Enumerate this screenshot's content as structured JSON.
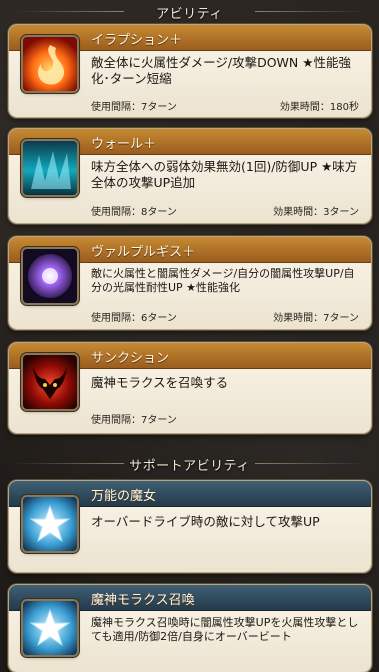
{
  "sections": {
    "abilities": "アビリティ",
    "support": "サポートアビリティ"
  },
  "abilities": [
    {
      "name": "イラプション＋",
      "desc": "敵全体に火属性ダメージ/攻撃DOWN ★性能強化･ターン短縮",
      "cooldown": "使用間隔：7ターン",
      "duration": "効果時間：180秒",
      "icon": "flame-icon",
      "color": "#d23a15"
    },
    {
      "name": "ウォール＋",
      "desc": "味方全体への弱体効果無効(1回)/防御UP ★味方全体の攻撃UP追加",
      "cooldown": "使用間隔：8ターン",
      "duration": "効果時間：3ターン",
      "icon": "water-wall-icon",
      "color": "#1ab3c7"
    },
    {
      "name": "ヴァルプルギス＋",
      "desc": "敵に火属性と闇属性ダメージ/自分の闇属性攻撃UP/自分の光属性耐性UP ★性能強化",
      "cooldown": "使用間隔：6ターン",
      "duration": "効果時間：7ターン",
      "icon": "dark-orb-icon",
      "color": "#7a3bd1"
    },
    {
      "name": "サンクション",
      "desc": "魔神モラクスを召喚する",
      "cooldown": "使用間隔：7ターン",
      "duration": "",
      "icon": "demon-icon",
      "color": "#b0150f"
    }
  ],
  "supports": [
    {
      "name": "万能の魔女",
      "desc": "オーバードライブ時の敵に対して攻撃UP",
      "icon": "star-icon",
      "color": "#3a9fd3"
    },
    {
      "name": "魔神モラクス召喚",
      "desc": "魔神モラクス召喚時に闇属性攻撃UPを火属性攻撃としても適用/防御2倍/自身にオーバービート",
      "icon": "star-icon",
      "color": "#3a9fd3"
    }
  ]
}
